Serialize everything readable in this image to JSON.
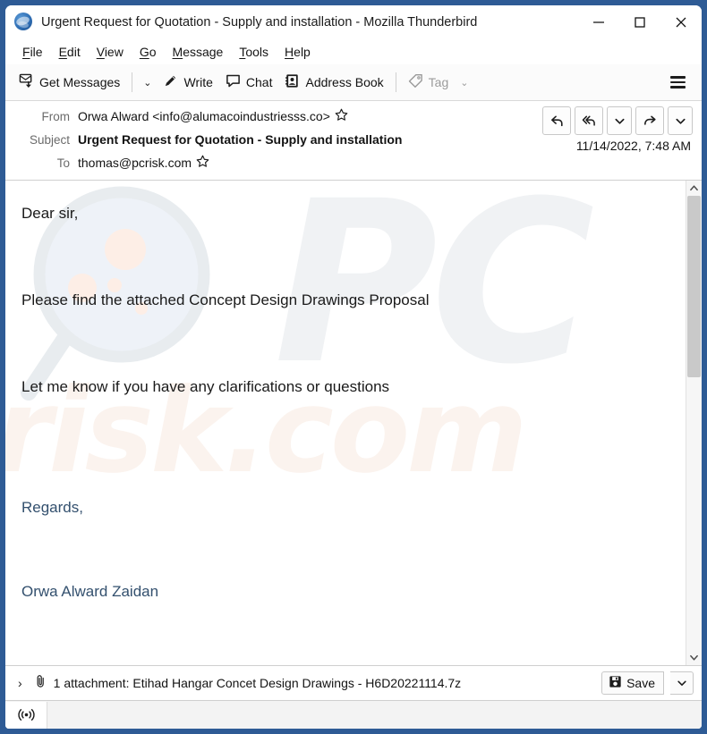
{
  "window": {
    "title": "Urgent Request for Quotation - Supply and installation - Mozilla Thunderbird",
    "app_icon": "thunderbird-icon",
    "minimize_label": "–",
    "maximize_label": "□",
    "close_label": "✕"
  },
  "menubar": {
    "items": [
      {
        "accel": "F",
        "rest": "ile"
      },
      {
        "accel": "E",
        "rest": "dit"
      },
      {
        "accel": "V",
        "rest": "iew"
      },
      {
        "accel": "G",
        "rest": "o"
      },
      {
        "accel": "M",
        "rest": "essage"
      },
      {
        "accel": "T",
        "rest": "ools"
      },
      {
        "accel": "H",
        "rest": "elp"
      }
    ]
  },
  "toolbar": {
    "get_messages_label": "Get Messages",
    "get_messages_chevron": "⌄",
    "write_label": "Write",
    "chat_label": "Chat",
    "address_book_label": "Address Book",
    "tag_label": "Tag",
    "tag_chevron": "⌄",
    "app_menu_label": "App Menu"
  },
  "message_header": {
    "from_label": "From",
    "from_value": "Orwa Alward <info@alumacoindustriesss.co>",
    "subject_label": "Subject",
    "subject_value": "Urgent Request for Quotation - Supply and installation",
    "to_label": "To",
    "to_value": "thomas@pcrisk.com",
    "date": "11/14/2022, 7:48 AM",
    "actions": [
      {
        "name": "reply-button",
        "icon": "reply-icon"
      },
      {
        "name": "reply-all-button",
        "icon": "reply-all-icon"
      },
      {
        "name": "reply-more-dropdown",
        "icon": "chevron-down-icon"
      },
      {
        "name": "forward-button",
        "icon": "forward-icon"
      },
      {
        "name": "more-actions-dropdown",
        "icon": "chevron-down-icon"
      }
    ]
  },
  "body": {
    "greeting": "Dear sir,",
    "line1": "Please find the attached Concept Design Drawings  Proposal",
    "line2": "Let me know if you have any clarifications or questions",
    "signoff": "Regards,",
    "signature": "Orwa Alward Zaidan",
    "watermark_pc": "PC",
    "watermark_risk": "risk.com",
    "watermark_glass": "magnifier-watermark"
  },
  "scrollbar": {
    "up_arrow": "⌃",
    "down_arrow": "⌄",
    "thumb_size_percent": 40
  },
  "attachment": {
    "expander": "›",
    "paperclip_icon": "paperclip-icon",
    "label": "1 attachment: Etihad Hangar Concet Design Drawings - H6D20221114.7z",
    "save_label": "Save",
    "save_chevron": "⌄"
  },
  "statusbar": {
    "icon": "broadcast-icon"
  },
  "colors": {
    "window_frame": "#2e5b95",
    "signature_text": "#33506e",
    "watermark_pc": "#f0f2f4",
    "watermark_risk": "#fbf3ee",
    "scrollbar_thumb": "#c9c9c9"
  }
}
